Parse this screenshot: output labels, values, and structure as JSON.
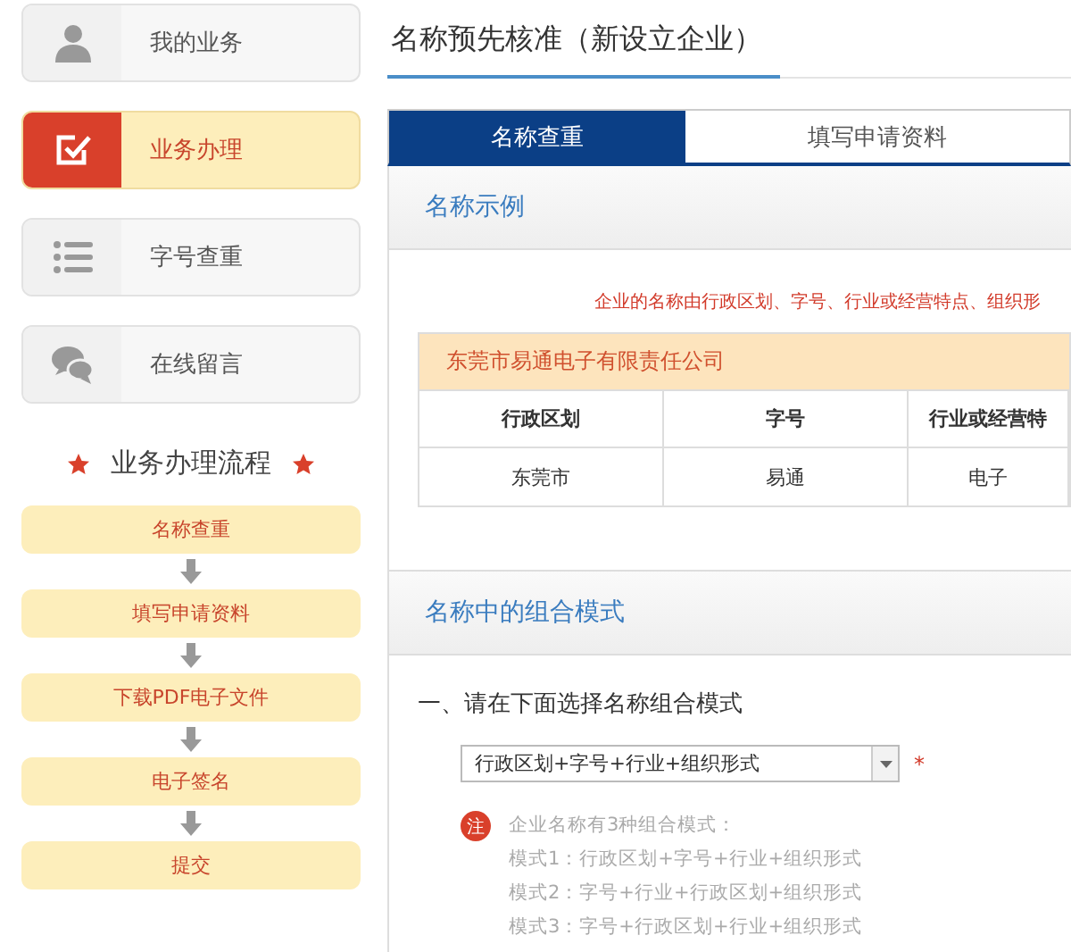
{
  "sidebar": {
    "items": [
      {
        "label": "我的业务",
        "selected": false
      },
      {
        "label": "业务办理",
        "selected": true
      },
      {
        "label": "字号查重",
        "selected": false
      },
      {
        "label": "在线留言",
        "selected": false
      }
    ],
    "flow": {
      "title": "业务办理流程",
      "steps": [
        "名称查重",
        "填写申请资料",
        "下载PDF电子文件",
        "电子签名",
        "提交"
      ]
    }
  },
  "main": {
    "title": "名称预先核准（新设立企业）",
    "tabs": [
      {
        "label": "名称查重",
        "selected": true
      },
      {
        "label": "填写申请资料",
        "selected": false
      }
    ],
    "example": {
      "heading": "名称示例",
      "notice": "企业的名称由行政区划、字号、行业或经营特点、组织形",
      "company": "东莞市易通电子有限责任公司",
      "columns": [
        "行政区划",
        "字号",
        "行业或经营特"
      ],
      "row": [
        "东莞市",
        "易通",
        "电子"
      ]
    },
    "pattern": {
      "heading": "名称中的组合模式",
      "question": "一、请在下面选择名称组合模式",
      "select_value": "行政区划+字号+行业+组织形式",
      "required_mark": "*",
      "note_badge": "注",
      "note_lines": [
        "企业名称有3种组合模式：",
        "模式1：行政区划+字号+行业+组织形式",
        "模式2：字号+行业+行政区划+组织形式",
        "模式3：字号+行政区划+行业+组织形式"
      ]
    }
  }
}
